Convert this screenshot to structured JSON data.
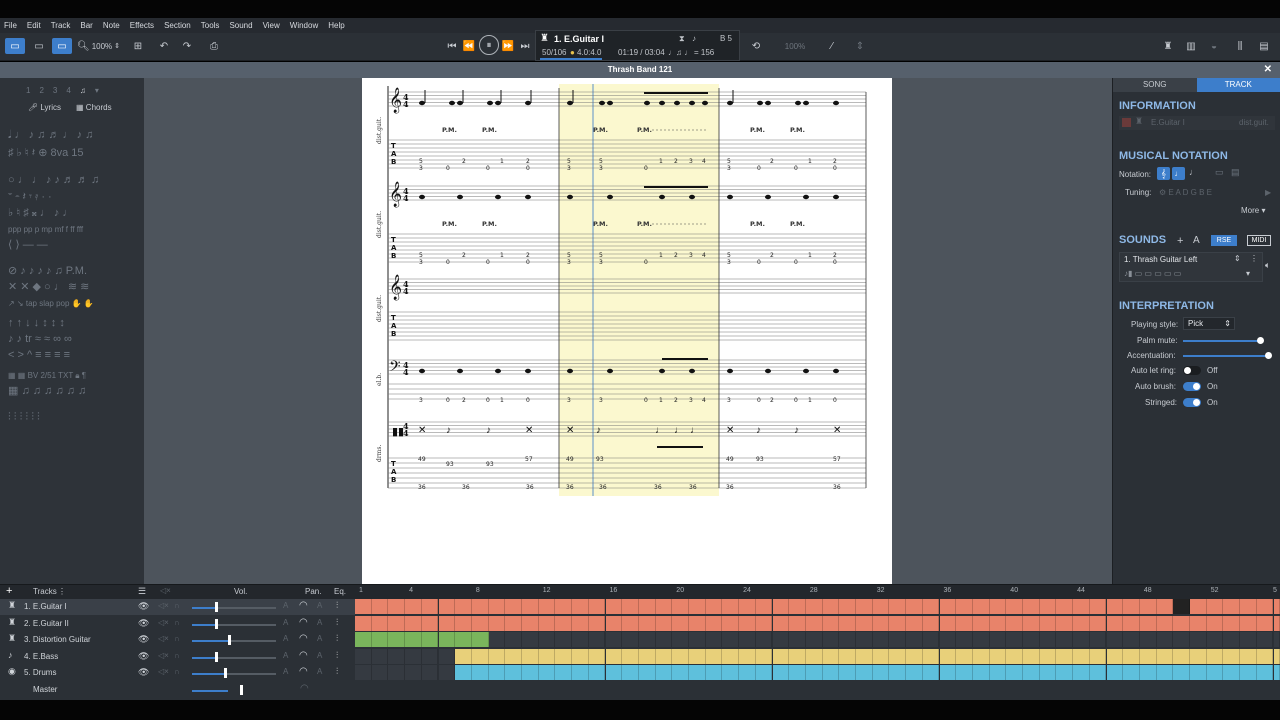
{
  "menu": [
    "File",
    "Edit",
    "Track",
    "Bar",
    "Note",
    "Effects",
    "Section",
    "Tools",
    "Sound",
    "View",
    "Window",
    "Help"
  ],
  "toolbar": {
    "zoom": "100%"
  },
  "lcd": {
    "track_name": "1. E.Guitar I",
    "bar_position": "50/106",
    "signature": "4.0:4.0",
    "time": "01:19 / 03:04",
    "tempo": "= 156",
    "key": "B 5"
  },
  "score_title": "Thrash Band 121",
  "left_panel": {
    "pages": [
      "1",
      "2",
      "3",
      "4"
    ],
    "lyrics": "Lyrics",
    "chords": "Chords"
  },
  "right_panel": {
    "tabs": [
      "SONG",
      "TRACK"
    ],
    "information": {
      "title": "INFORMATION",
      "name": "E.Guitar I",
      "short": "dist.guit."
    },
    "notation": {
      "title": "MUSICAL NOTATION",
      "label": "Notation:",
      "tuning_label": "Tuning:",
      "tuning": "E A D G B E",
      "more": "More"
    },
    "sounds": {
      "title": "SOUNDS",
      "rse": "RSE",
      "midi": "MIDI",
      "sound": "1. Thrash Guitar Left"
    },
    "interpretation": {
      "title": "INTERPRETATION",
      "playing_style_label": "Playing style:",
      "playing_style": "Pick",
      "palm_mute": "Palm mute:",
      "accentuation": "Accentuation:",
      "auto_let_ring": "Auto let ring:",
      "auto_let_ring_val": "Off",
      "auto_brush": "Auto brush:",
      "auto_brush_val": "On",
      "stringed": "Stringed:",
      "stringed_val": "On"
    }
  },
  "score": {
    "staff_labels": [
      "dist.guit.",
      "dist.guit.",
      "dist.guit.",
      "el.b.",
      "drms."
    ],
    "pm": "P.M.",
    "tab_row_a": [
      "5",
      "3",
      "0",
      "2",
      "0",
      "1",
      "2",
      "0",
      "5",
      "3",
      "5",
      "3",
      "0",
      "1",
      "2",
      "3",
      "4",
      "5",
      "3",
      "0",
      "2",
      "0",
      "1",
      "2",
      "0"
    ],
    "drum_top": [
      "49",
      "93",
      "93",
      "57",
      "49",
      "93",
      "49",
      "93",
      "57"
    ],
    "drum_bottom": [
      "36",
      "36",
      "36",
      "36",
      "36",
      "36",
      "36",
      "36",
      "36"
    ]
  },
  "tracks": {
    "header": {
      "tracks": "Tracks",
      "vol": "Vol.",
      "pan": "Pan.",
      "eq": "Eq."
    },
    "items": [
      {
        "name": "1. E.Guitar I"
      },
      {
        "name": "2. E.Guitar II"
      },
      {
        "name": "3. Distortion Guitar"
      },
      {
        "name": "4. E.Bass"
      },
      {
        "name": "5. Drums"
      }
    ],
    "master": "Master",
    "volume_levels": [
      0.55,
      0.55,
      0.85,
      0.55,
      0.75,
      0.75
    ],
    "ruler": [
      "1",
      "4",
      "8",
      "12",
      "16",
      "20",
      "24",
      "28",
      "32",
      "36",
      "40",
      "44",
      "48",
      "52",
      "5"
    ]
  },
  "colors": {
    "accent": "#3d7ecb",
    "guitar": "#e8836a",
    "distortion": "#7ab55c",
    "bass": "#e8d07a",
    "drums": "#5ec0dc",
    "highlight": "#fbf8cf"
  }
}
